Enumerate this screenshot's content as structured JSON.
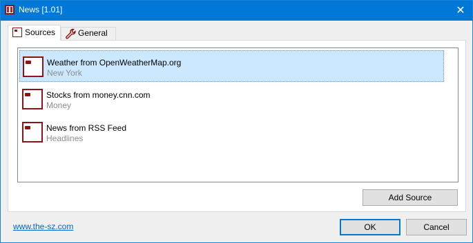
{
  "window": {
    "title": "News [1.01]",
    "close_glyph": "✕"
  },
  "tabs": [
    {
      "label": "Sources",
      "icon": "news-source-icon",
      "selected": true
    },
    {
      "label": "General",
      "icon": "wrench-icon",
      "selected": false
    }
  ],
  "sources": {
    "items": [
      {
        "title": "Weather from OpenWeatherMap.org",
        "subtitle": "New York",
        "icon": "news-source-icon",
        "selected": true
      },
      {
        "title": "Stocks from money.cnn.com",
        "subtitle": "Money",
        "icon": "news-source-icon",
        "selected": false
      },
      {
        "title": "News from RSS Feed",
        "subtitle": "Headlines",
        "icon": "news-source-icon",
        "selected": false
      }
    ],
    "add_label": "Add Source"
  },
  "footer": {
    "link_text": "www.the-sz.com",
    "ok_label": "OK",
    "cancel_label": "Cancel"
  },
  "colors": {
    "titlebar": "#0078d7",
    "selection": "#cce8ff",
    "icon_accent": "#8b1414",
    "link": "#0066cc"
  }
}
